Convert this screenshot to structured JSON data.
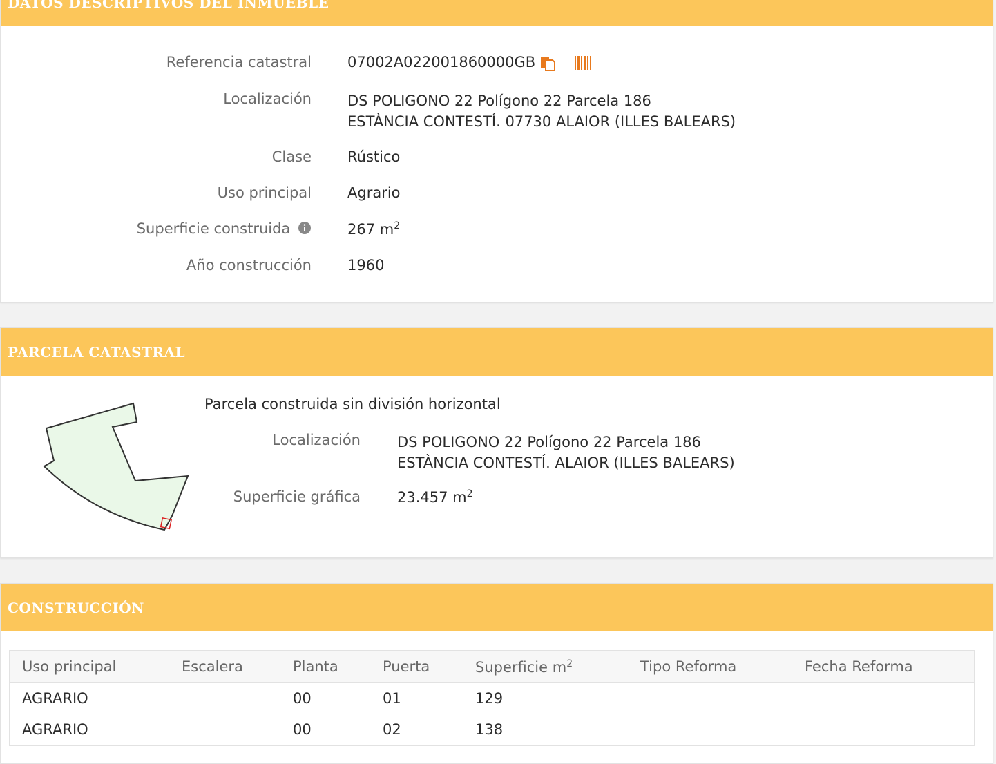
{
  "datos": {
    "header": "DATOS DESCRIPTIVOS DEL INMUEBLE",
    "rows": [
      {
        "label": "Referencia catastral",
        "value": "07002A022001860000GB"
      },
      {
        "label": "Localización",
        "value_line1": "DS POLIGONO 22 Polígono 22 Parcela 186",
        "value_line2": "ESTÀNCIA CONTESTÍ. 07730 ALAIOR (ILLES BALEARS)"
      },
      {
        "label": "Clase",
        "value": "Rústico"
      },
      {
        "label": "Uso principal",
        "value": "Agrario"
      },
      {
        "label": "Superficie construida",
        "value": "267 m",
        "unit_sup": "2"
      },
      {
        "label": "Año construcción",
        "value": "1960"
      }
    ],
    "icons": [
      "copy-icon",
      "barcode-icon",
      "info-icon"
    ],
    "accent_color": "#e87a1e"
  },
  "parcela": {
    "header": "PARCELA CATASTRAL",
    "title": "Parcela construida sin división horizontal",
    "rows": [
      {
        "label": "Localización",
        "value_line1": "DS POLIGONO 22 Polígono 22 Parcela 186",
        "value_line2": "ESTÀNCIA CONTESTÍ. ALAIOR (ILLES BALEARS)"
      },
      {
        "label": "Superficie gráfica",
        "value": "23.457 m",
        "unit_sup": "2"
      }
    ]
  },
  "construccion": {
    "header": "CONSTRUCCIÓN",
    "columns": [
      "Uso principal",
      "Escalera",
      "Planta",
      "Puerta",
      "Superficie m",
      "Tipo Reforma",
      "Fecha Reforma"
    ],
    "superficie_sup": "2",
    "rows": [
      [
        "AGRARIO",
        "",
        "00",
        "01",
        "129",
        "",
        ""
      ],
      [
        "AGRARIO",
        "",
        "00",
        "02",
        "138",
        "",
        ""
      ]
    ]
  },
  "colors": {
    "header_bg": "#fcc65a",
    "header_text": "#ffffff"
  }
}
